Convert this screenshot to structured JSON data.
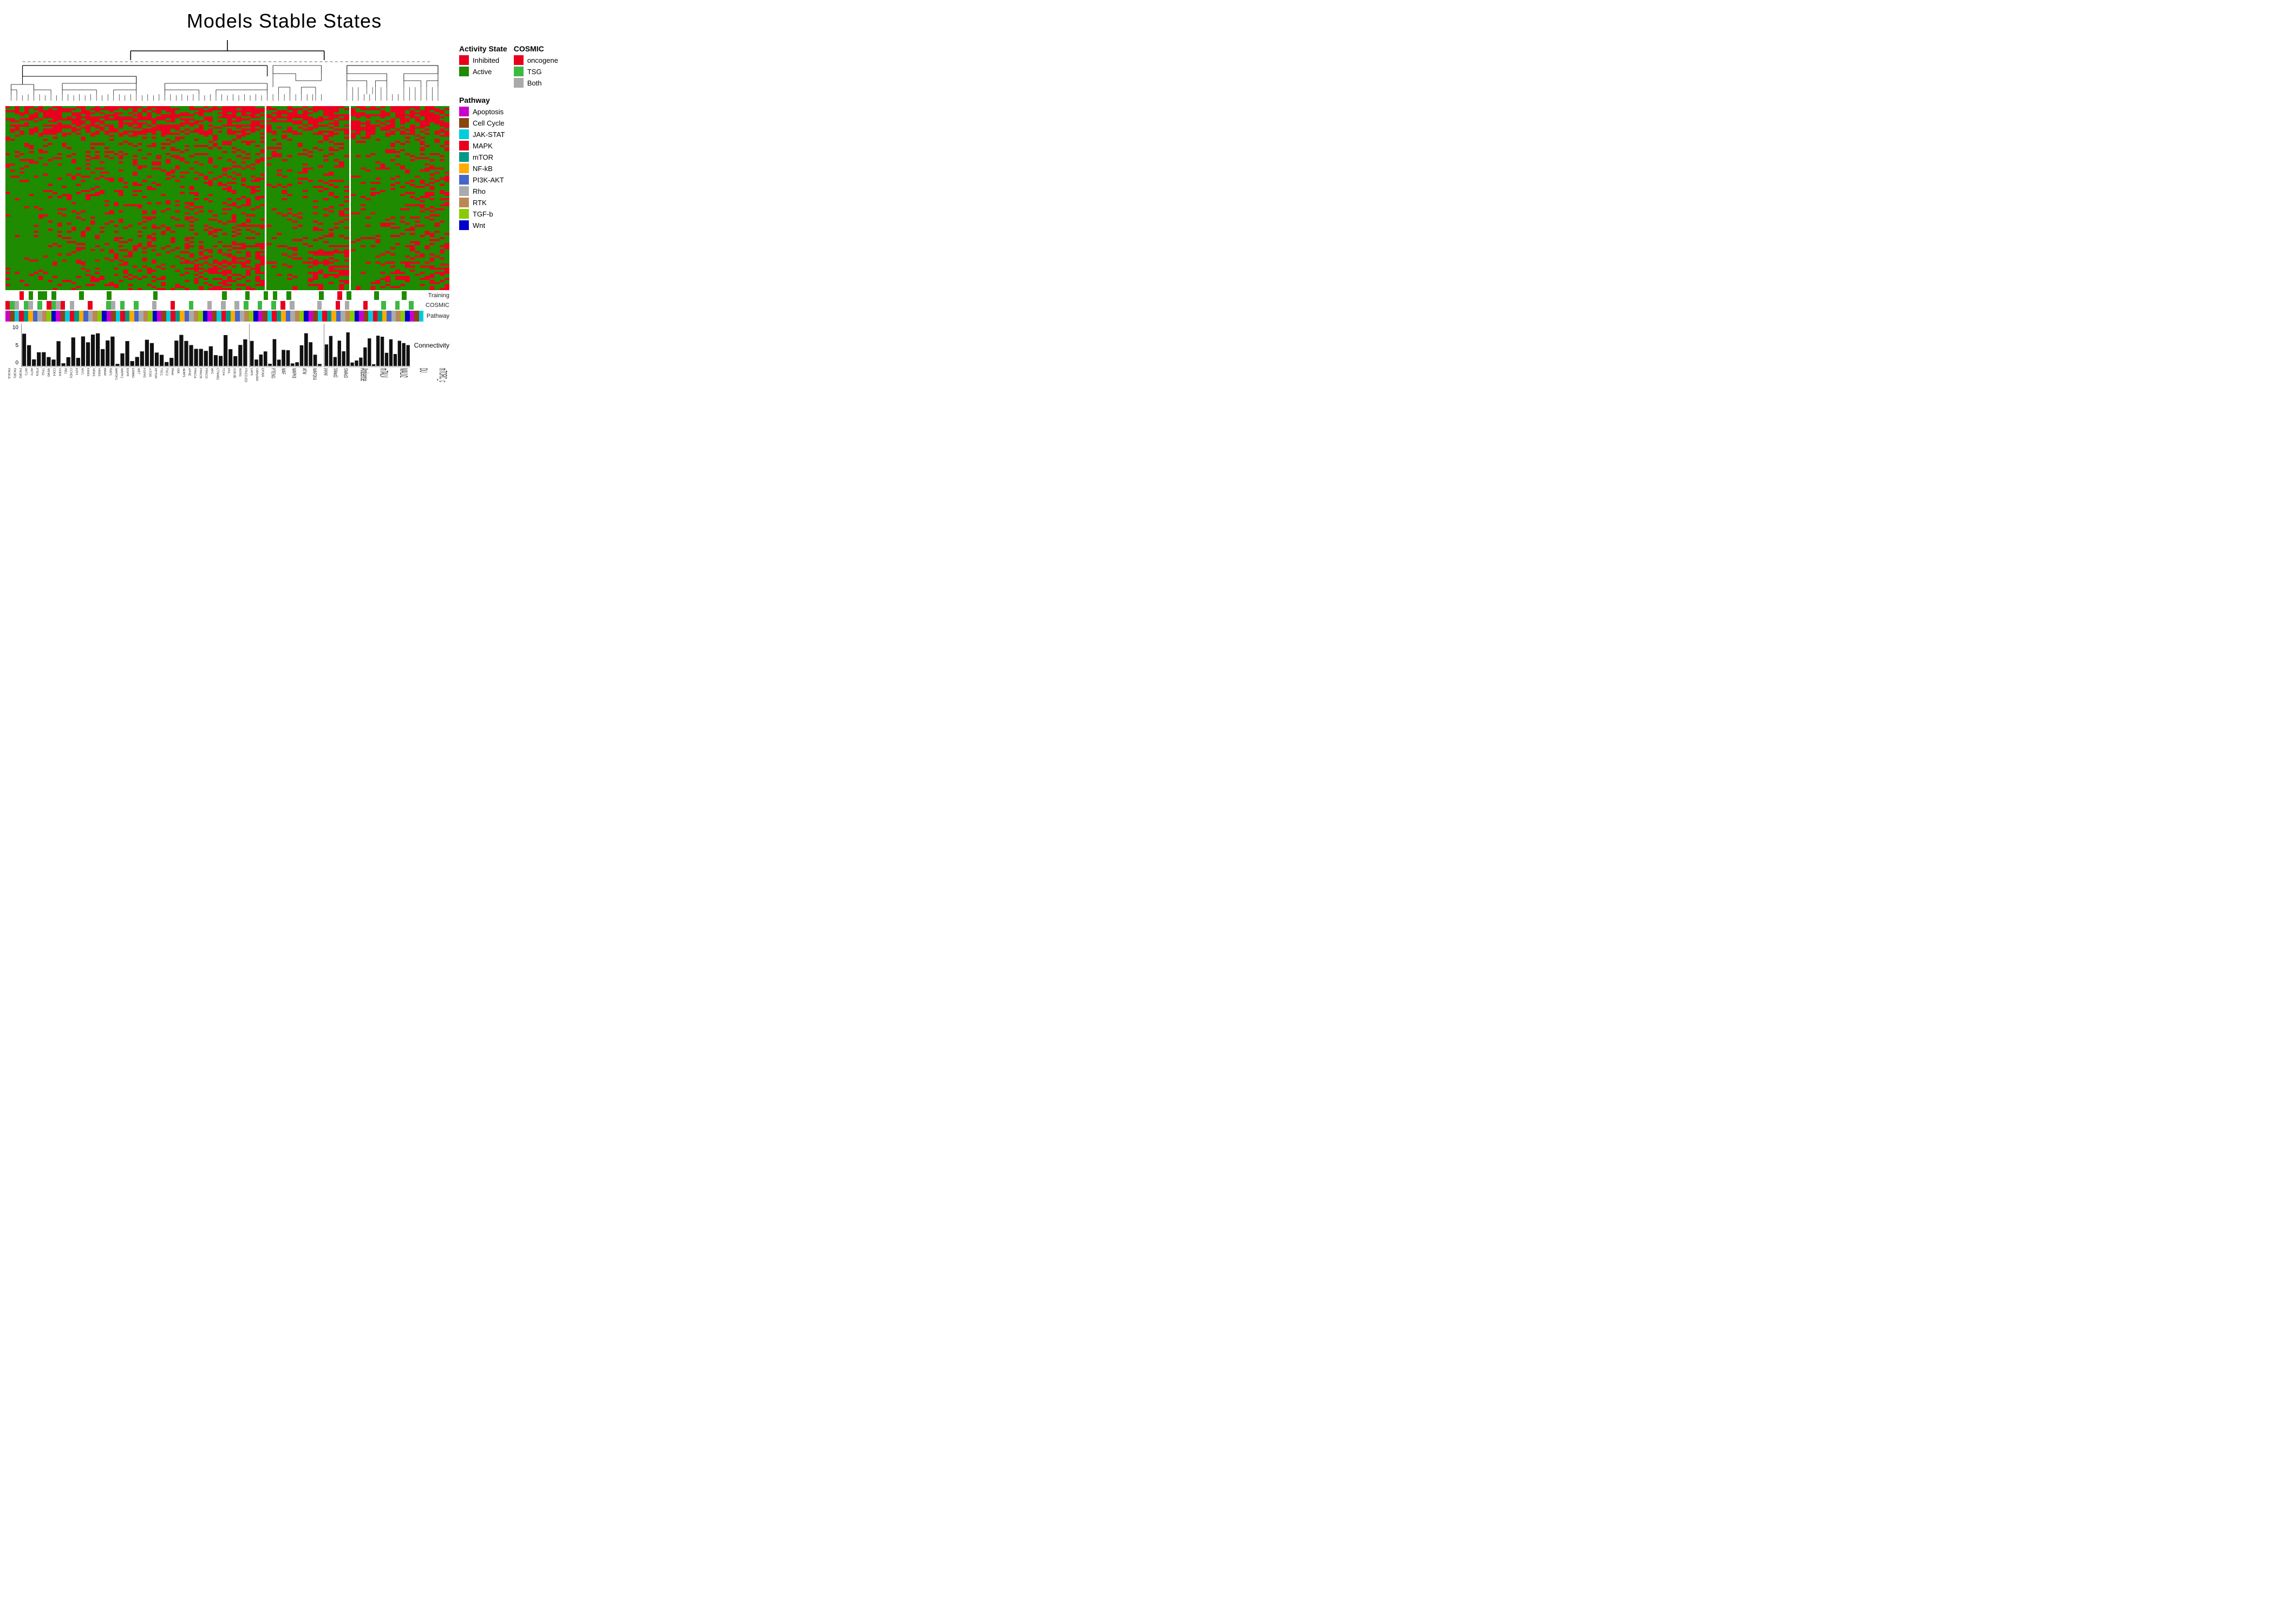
{
  "title": "Models Stable States",
  "legend": {
    "activity_state": {
      "title": "Activity State",
      "items": [
        {
          "label": "Inhibited",
          "color": "#e8001e"
        },
        {
          "label": "Active",
          "color": "#1e8b00"
        }
      ]
    },
    "cosmic": {
      "title": "COSMIC",
      "items": [
        {
          "label": "oncogene",
          "color": "#e8001e"
        },
        {
          "label": "TSG",
          "color": "#3db843"
        },
        {
          "label": "Both",
          "color": "#aaaaaa"
        }
      ]
    },
    "pathway": {
      "title": "Pathway",
      "items": [
        {
          "label": "Apoptosis",
          "color": "#cc00cc"
        },
        {
          "label": "Cell Cycle",
          "color": "#8b4513"
        },
        {
          "label": "JAK-STAT",
          "color": "#00ccdd"
        },
        {
          "label": "MAPK",
          "color": "#e8001e"
        },
        {
          "label": "mTOR",
          "color": "#009988"
        },
        {
          "label": "NF-kB",
          "color": "#ffaa00"
        },
        {
          "label": "PI3K-AKT",
          "color": "#4466cc"
        },
        {
          "label": "Rho",
          "color": "#aaaaaa"
        },
        {
          "label": "RTK",
          "color": "#bb8855"
        },
        {
          "label": "TGF-b",
          "color": "#88cc00"
        },
        {
          "label": "Wnt",
          "color": "#0000cc"
        }
      ]
    }
  },
  "annotations": {
    "training_label": "Training",
    "cosmic_label": "COSMIC",
    "pathway_label": "Pathway",
    "connectivity_label": "Connectivity"
  },
  "connectivity_y_axis": [
    "10",
    "5",
    "0"
  ]
}
